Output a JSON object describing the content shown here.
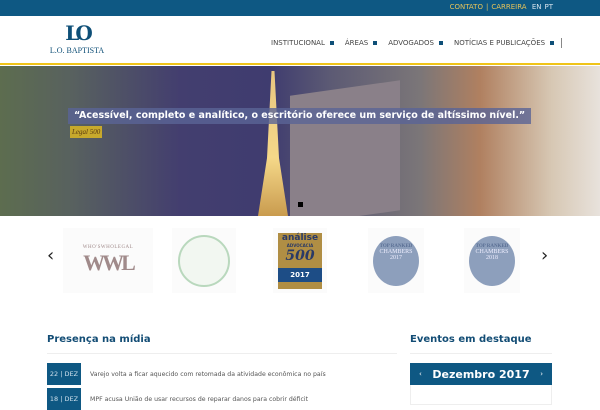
{
  "topbar": {
    "contato": "CONTATO",
    "separator": "|",
    "carreira": "CARREIRA",
    "en": "EN",
    "pt": "PT"
  },
  "logo": {
    "mark": "LO",
    "name": "L.O. BAPTISTA"
  },
  "nav": [
    {
      "label": "INSTITUCIONAL"
    },
    {
      "label": "ÁREAS"
    },
    {
      "label": "ADVOGADOS"
    },
    {
      "label": "NOTÍCIAS E PUBLICAÇÕES"
    }
  ],
  "hero": {
    "quote": "“Acessível, completo e analítico, o escritório oferece um serviço de altíssimo nível.”",
    "source": "Legal 500"
  },
  "awards": {
    "wwl_small": "WHO'SWHOLEGAL",
    "wwl_big": "WWL",
    "analise_title": "análise",
    "analise_sub": "ADVOCACIA",
    "analise_num": "500",
    "analise_year": "2017",
    "chambers1_top": "TOP RANKED",
    "chambers1_name": "CHAMBERS",
    "chambers1_year": "2017",
    "chambers2_top": "TOP RANKED",
    "chambers2_name": "CHAMBERS",
    "chambers2_year": "2018"
  },
  "media": {
    "title": "Presença na mídia",
    "items": [
      {
        "date": "22 | DEZ",
        "text": "Varejo volta a ficar aquecido com retomada da atividade econômica no país"
      },
      {
        "date": "18 | DEZ",
        "text": "MPF acusa União de usar recursos de reparar danos para cobrir déficit"
      }
    ]
  },
  "events": {
    "title": "Eventos em destaque",
    "month": "Dezembro 2017",
    "prev": "‹",
    "next": "›"
  }
}
